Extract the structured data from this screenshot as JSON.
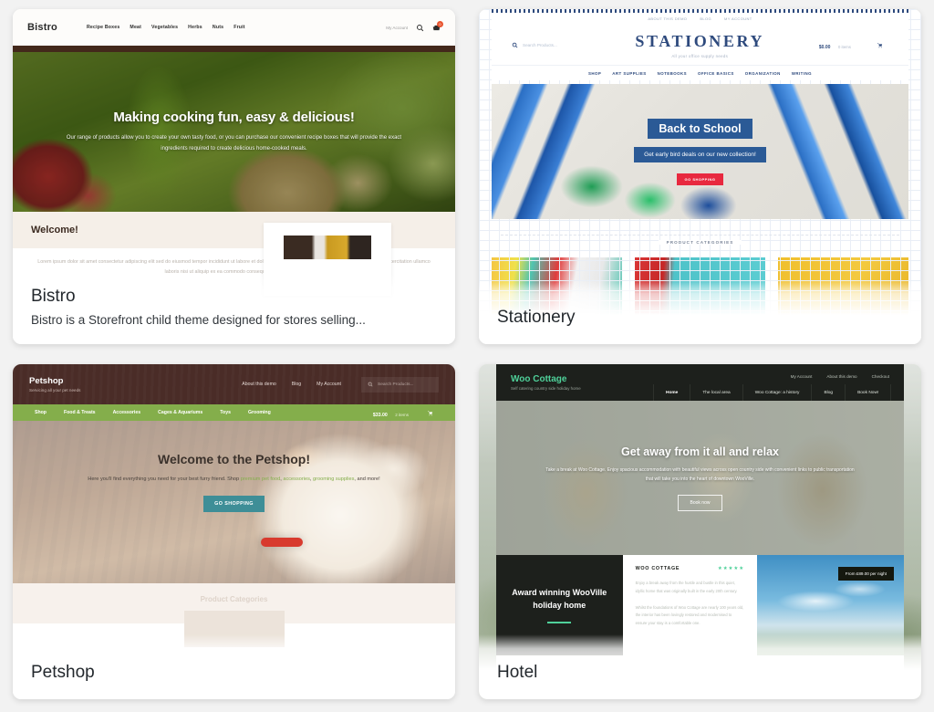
{
  "page": {
    "background": "#f2f2f2"
  },
  "cards": [
    {
      "title": "Bistro",
      "description": "Bistro is a Storefront child theme designed for stores selling...",
      "preview": {
        "logo": "Bistro",
        "nav": [
          "Recipe Boxes",
          "Meat",
          "Vegetables",
          "Herbs",
          "Nuts",
          "Fruit"
        ],
        "account_label": "My Account",
        "cart_count": "0",
        "hero_heading": "Making cooking fun, easy & delicious!",
        "hero_paragraph": "Our range of products allow you to create your own tasty food, or you can purchase our convenient recipe boxes that will provide the exact ingredients required to create delicious home-cooked meals.",
        "welcome_heading": "Welcome!",
        "body_paragraph": "Lorem ipsum dolor sit amet consectetur adipiscing elit sed do eiusmod tempor incididunt ut labore et dolore magna aliqua ut enim ad minim veniam quis nostrud exercitation ullamco laboris nisi ut aliquip ex ea commodo consequat duis aute irure."
      }
    },
    {
      "title": "Stationery",
      "description": "",
      "preview": {
        "topbar": [
          "ABOUT THIS DEMO",
          "BLOG",
          "MY ACCOUNT"
        ],
        "search_placeholder": "Search Products...",
        "brand": "STATIONERY",
        "tagline": "All your office supply needs",
        "cart_price": "$0.00",
        "cart_items": "0 items",
        "nav": [
          "SHOP",
          "ART SUPPLIES",
          "NOTEBOOKS",
          "OFFICE BASICS",
          "ORGANIZATION",
          "WRITING"
        ],
        "hero_heading": "Back to School",
        "hero_subheading": "Get early bird deals on our new collection!",
        "hero_button": "GO SHOPPING",
        "categories_heading": "PRODUCT CATEGORIES"
      }
    },
    {
      "title": "Petshop",
      "description": "",
      "preview": {
        "logo": "Petshop",
        "tagline": "Servicing all your pet needs",
        "nav": [
          "About this demo",
          "Blog",
          "My Account"
        ],
        "search_placeholder": "Search Products...",
        "menu": [
          "Shop",
          "Food & Treats",
          "Accessories",
          "Cages & Aquariums",
          "Toys",
          "Grooming"
        ],
        "cart_price": "$33.00",
        "cart_items": "2 items",
        "hero_heading": "Welcome to the Petshop!",
        "hero_text_1": "Here you'll find everything you need for your best furry friend. Shop ",
        "hero_link_1": "premium pet food",
        "hero_text_2": ", ",
        "hero_link_2": "accessories",
        "hero_text_3": ", ",
        "hero_link_3": "grooming supplies",
        "hero_text_4": ", and more!",
        "hero_button": "GO SHOPPING",
        "categories_heading": "Product Categories"
      }
    },
    {
      "title": "Hotel",
      "description": "",
      "preview": {
        "logo": "Woo Cottage",
        "tagline": "Self catering country side holiday home",
        "topnav": [
          "My Account",
          "About this demo",
          "Checkout"
        ],
        "menu": [
          "Home",
          "The local area",
          "Woo Cottage: a history",
          "Blog",
          "Book Now!"
        ],
        "hero_heading": "Get away from it all and relax",
        "hero_paragraph": "Take a break at Woo Cottage. Enjoy spacious accommodation with beautiful views across open country side with convenient links to public transportation that will take you into the heart of downtown WooVille.",
        "hero_button": "Book now",
        "feature_heading": "Award winning WooVille holiday home",
        "panel_title": "WOO COTTAGE",
        "panel_stars": "★★★★★",
        "panel_paragraph_1": "Enjoy a break away from the hustle and bustle in this quiet, idyllic home that was originally built in the early 20th century.",
        "panel_paragraph_2": "Whilst the foundations of Woo Cottage are nearly 100 years old, the interior has been lovingly restored and modernised to ensure your stay is a comfortable one.",
        "price_badge": "From £89.00 per night"
      }
    }
  ],
  "colors": {
    "bistro_accent": "#43281b",
    "stationery_accent": "#2e4a7d",
    "stationery_button": "#e8293f",
    "petshop_header": "#4a2c27",
    "petshop_menu": "#84ae4b",
    "petshop_button": "#3e8e97",
    "hotel_header": "#1d201c",
    "hotel_accent": "#4fd19a"
  }
}
